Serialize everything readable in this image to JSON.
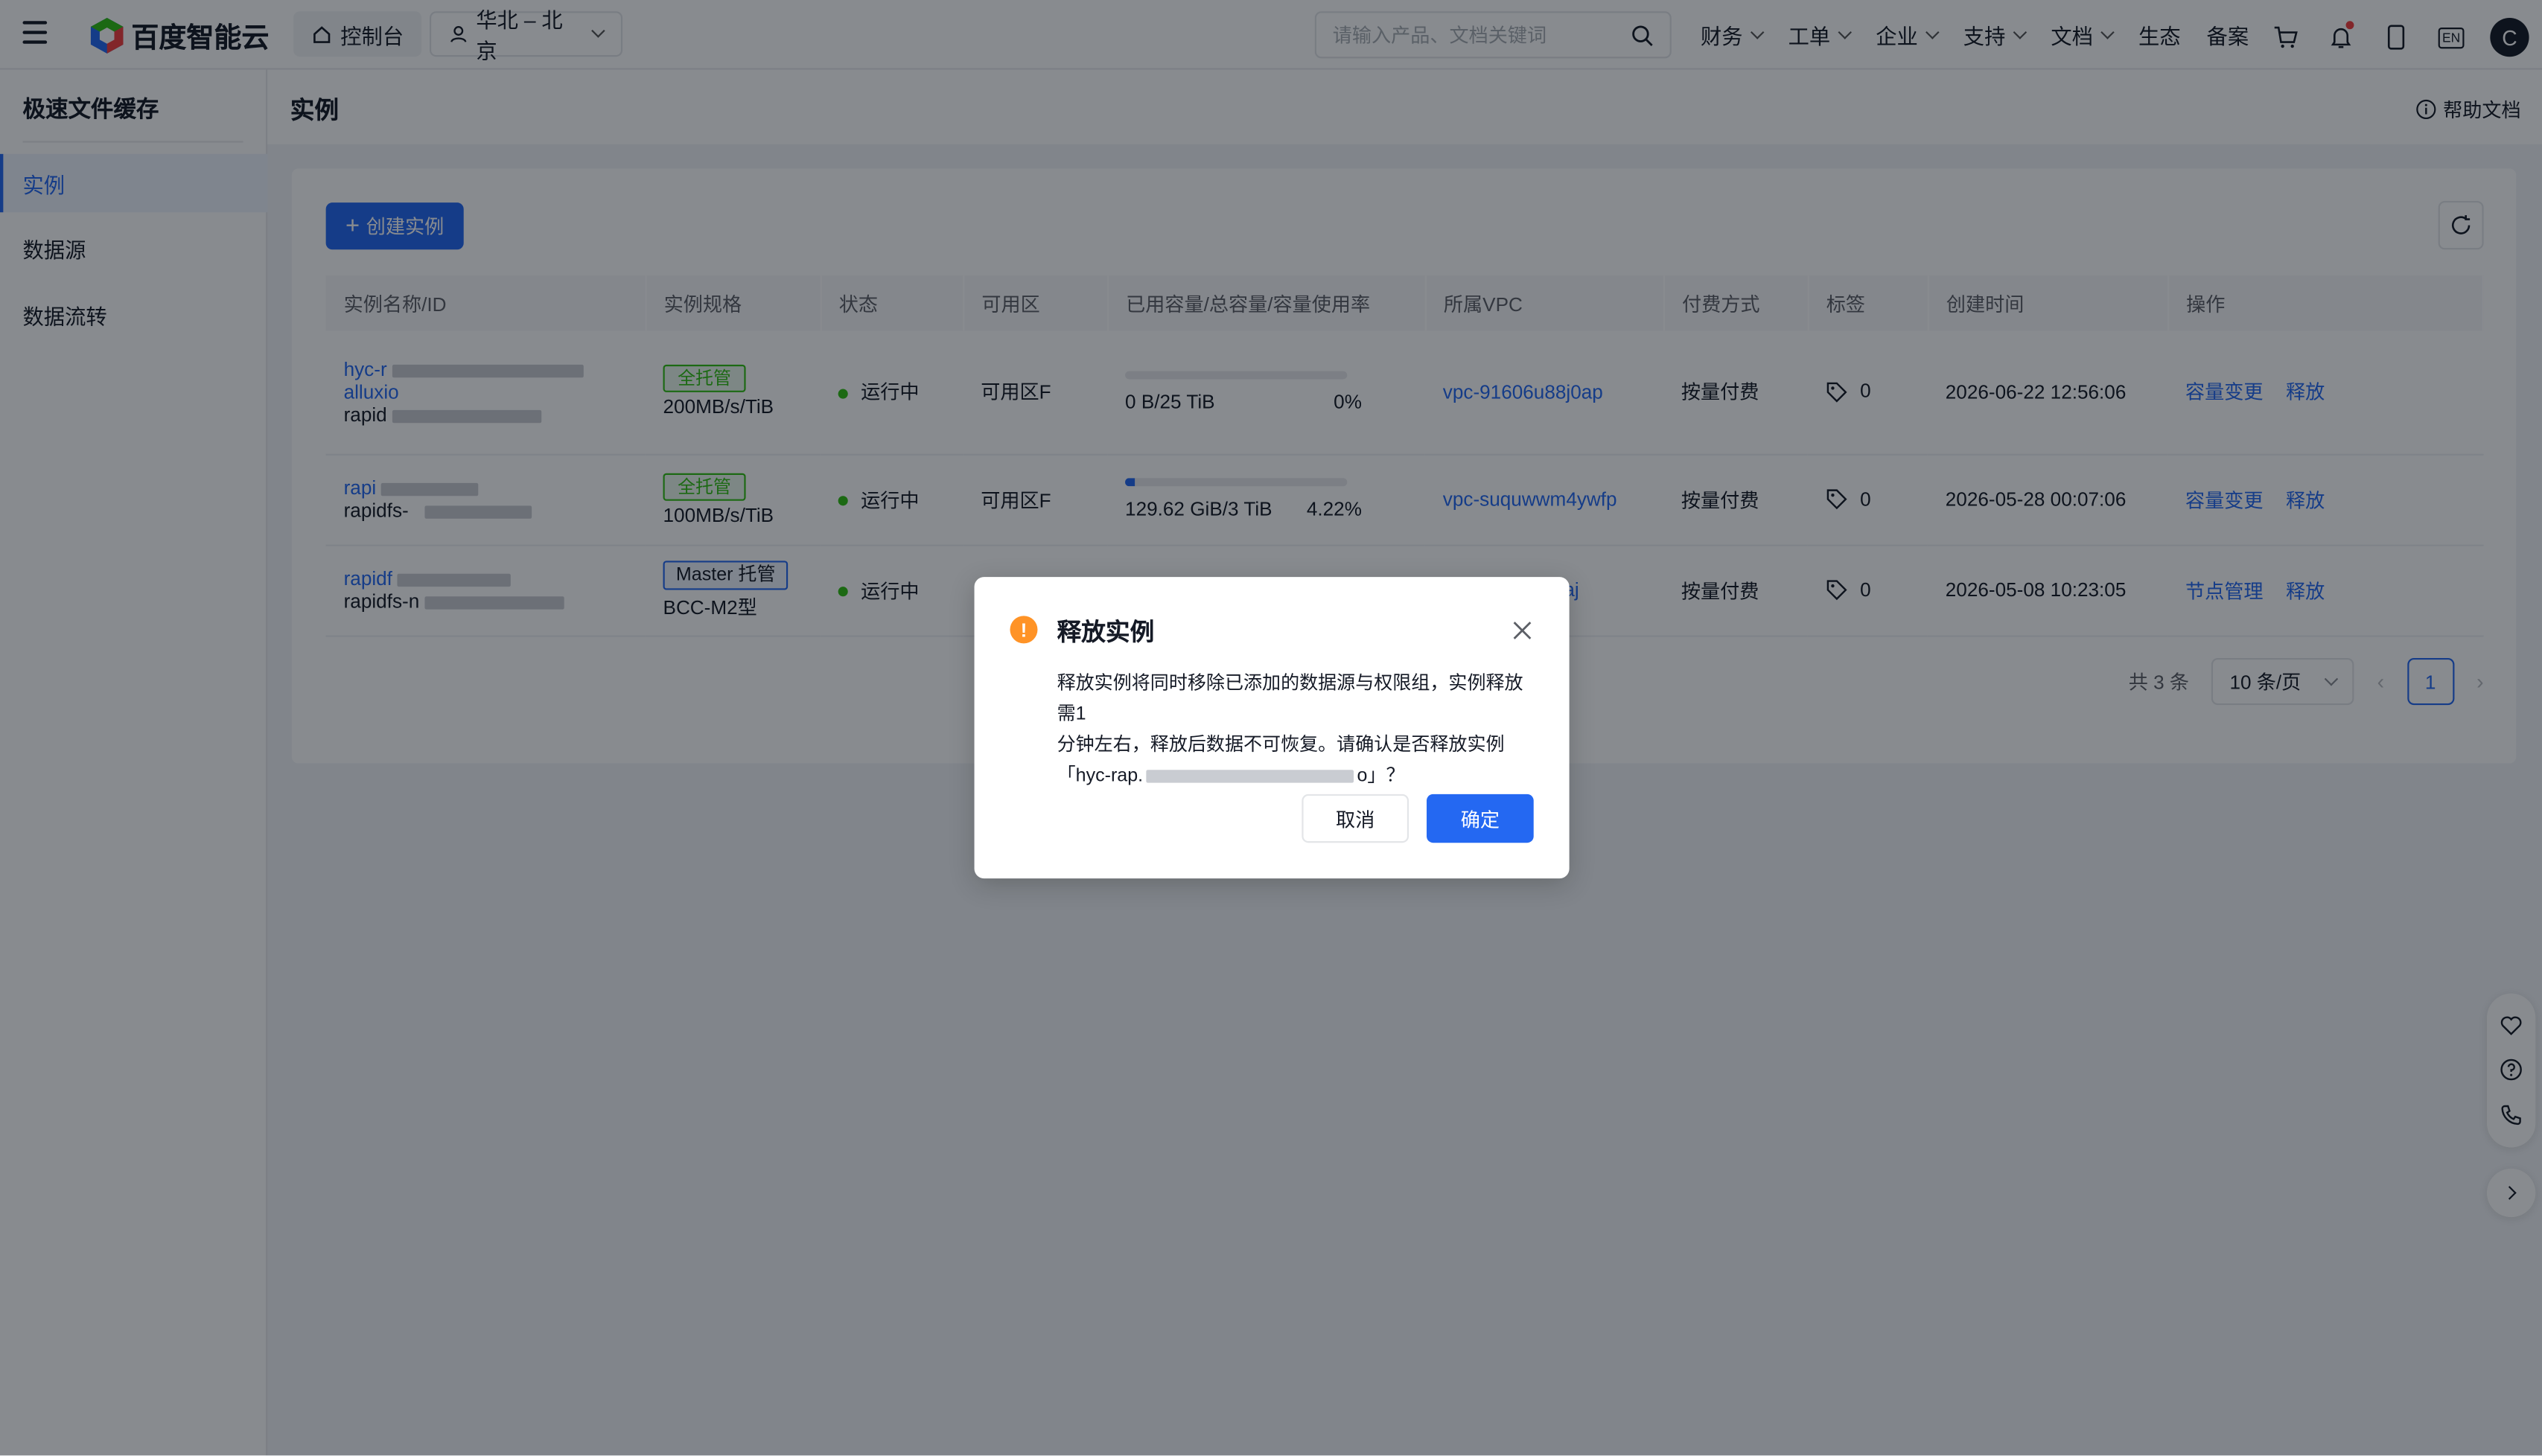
{
  "header": {
    "brand": "百度智能云",
    "console_label": "控制台",
    "region_label": "华北 – 北京",
    "search_placeholder": "请输入产品、文档关键词",
    "nav": [
      "财务",
      "工单",
      "企业",
      "支持",
      "文档",
      "生态",
      "备案"
    ],
    "lang_label": "EN",
    "avatar_initial": "C"
  },
  "sidebar": {
    "title": "极速文件缓存",
    "items": [
      {
        "label": "实例",
        "active": true
      },
      {
        "label": "数据源",
        "active": false
      },
      {
        "label": "数据流转",
        "active": false
      }
    ]
  },
  "page": {
    "title": "实例",
    "help_label": "帮助文档",
    "create_label": "创建实例"
  },
  "table": {
    "columns": [
      "实例名称/ID",
      "实例规格",
      "状态",
      "可用区",
      "已用容量/总容量/容量使用率",
      "所属VPC",
      "付费方式",
      "标签",
      "创建时间",
      "操作"
    ],
    "rows": [
      {
        "name_prefix": "hyc-r",
        "name_suffix": "alluxio",
        "id_prefix": "rapid",
        "spec_tag": "全托管",
        "spec_sub": "200MB/s/TiB",
        "status": "运行中",
        "zone": "可用区F",
        "used_capacity": "0 B/25 TiB",
        "usage_rate": "0%",
        "usage_fraction": 0.0,
        "vpc": "vpc-91606u88j0ap",
        "billing": "按量付费",
        "tag_count": "0",
        "created": "2026-06-22 12:56:06",
        "op1": "容量变更",
        "op2": "释放"
      },
      {
        "name_prefix": "rapi",
        "id_prefix": "rapidfs-",
        "spec_tag": "全托管",
        "spec_sub": "100MB/s/TiB",
        "status": "运行中",
        "zone": "可用区F",
        "used_capacity": "129.62 GiB/3 TiB",
        "usage_rate": "4.22%",
        "usage_fraction": 0.0422,
        "vpc": "vpc-suquwwm4ywfp",
        "billing": "按量付费",
        "tag_count": "0",
        "created": "2026-05-28 00:07:06",
        "op1": "容量变更",
        "op2": "释放"
      },
      {
        "name_prefix": "rapidf",
        "id_prefix": "rapidfs-n",
        "spec_tag": "Master 托管",
        "spec_sub": "BCC-M2型",
        "status": "运行中",
        "vpc_suffix": "haj",
        "billing": "按量付费",
        "tag_count": "0",
        "created": "2026-05-08 10:23:05",
        "op1": "节点管理",
        "op2": "释放"
      }
    ]
  },
  "pagination": {
    "total": "共 3 条",
    "page_size": "10 条/页",
    "current_page": "1"
  },
  "dialog": {
    "title": "释放实例",
    "body_line1": "释放实例将同时移除已添加的数据源与权限组，实例释放需1",
    "body_line2": "分钟左右，释放后数据不可恢复。请确认是否释放实例",
    "body_line3_prefix": "「hyc-rap.",
    "body_line3_suffix": "o」？",
    "cancel_label": "取消",
    "ok_label": "确定"
  },
  "colors": {
    "accent": "#2468f2",
    "success": "#30bf13",
    "warning": "#ff9326",
    "overlay": "rgba(7,12,20,0.48)"
  }
}
